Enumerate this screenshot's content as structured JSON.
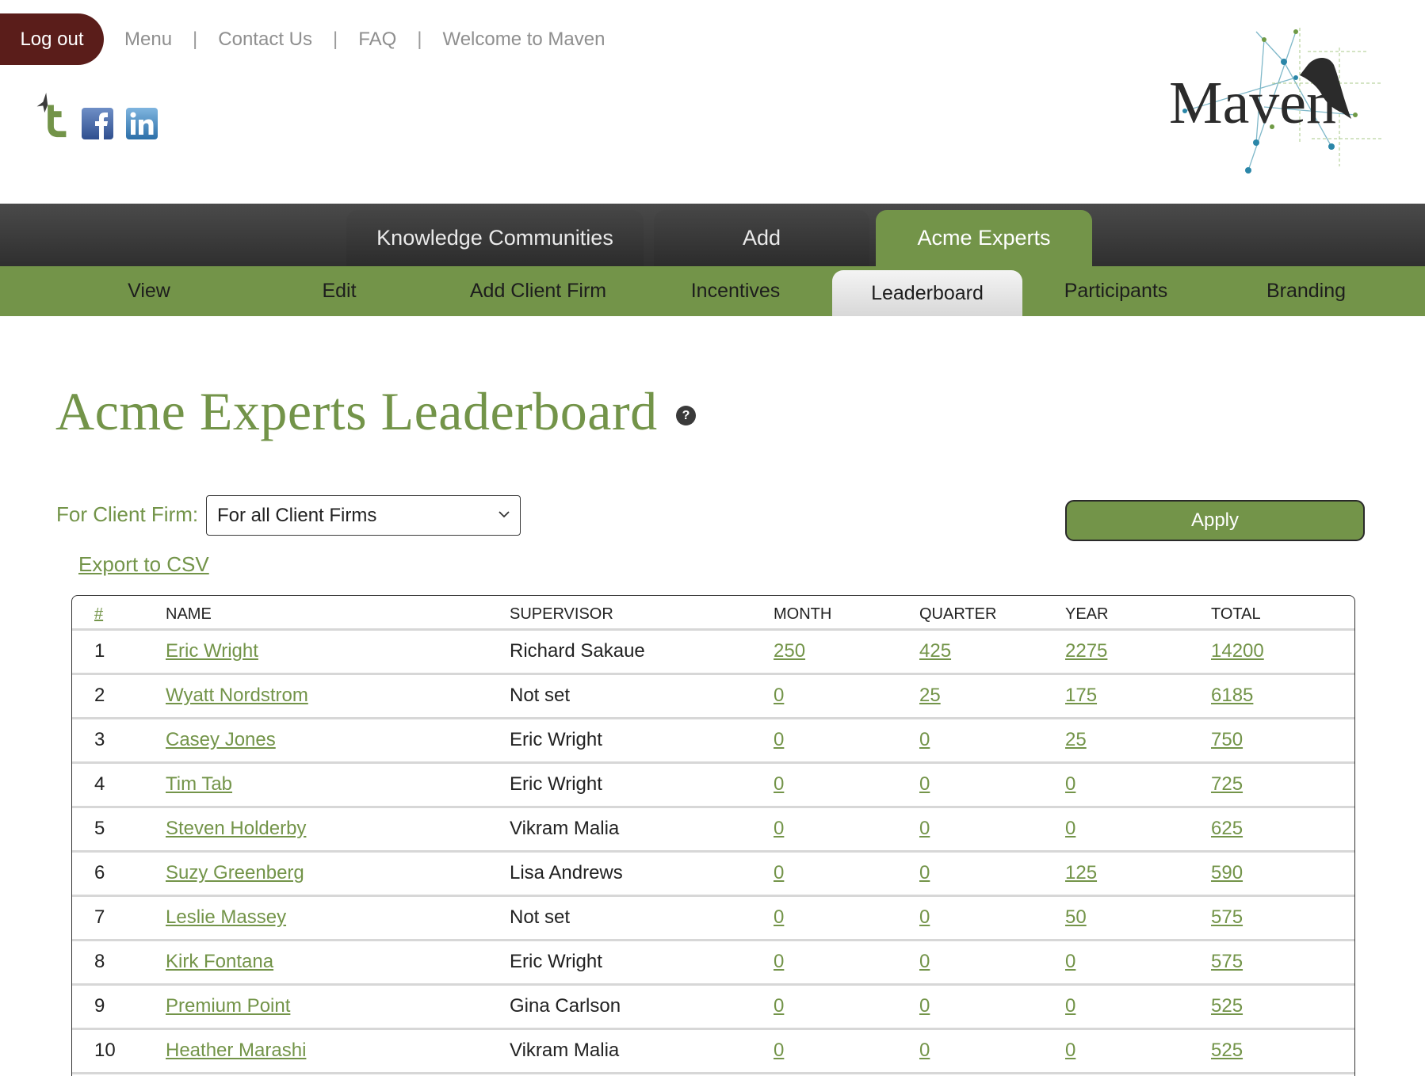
{
  "header": {
    "logout_label": "Log out",
    "links": [
      "Menu",
      "Contact Us",
      "FAQ",
      "Welcome to Maven"
    ],
    "separator": "|",
    "logo_text": "Maven"
  },
  "social": {
    "icons": [
      "twitter-icon",
      "facebook-icon",
      "linkedin-icon"
    ]
  },
  "nav_primary": {
    "tabs": [
      {
        "label": "Knowledge Communities",
        "active": false
      },
      {
        "label": "Add",
        "active": false
      },
      {
        "label": "Acme Experts",
        "active": true
      }
    ]
  },
  "nav_secondary": {
    "tabs": [
      {
        "label": "View",
        "active": false
      },
      {
        "label": "Edit",
        "active": false
      },
      {
        "label": "Add Client Firm",
        "active": false
      },
      {
        "label": "Incentives",
        "active": false
      },
      {
        "label": "Leaderboard",
        "active": true
      },
      {
        "label": "Participants",
        "active": false
      },
      {
        "label": "Branding",
        "active": false
      }
    ]
  },
  "main": {
    "title": "Acme Experts Leaderboard",
    "help_glyph": "?",
    "filter_label": "For Client Firm:",
    "filter_value": "For all Client Firms",
    "apply_label": "Apply",
    "export_label": "Export to CSV"
  },
  "leaderboard": {
    "columns": [
      "#",
      "NAME",
      "SUPERVISOR",
      "MONTH",
      "QUARTER",
      "YEAR",
      "TOTAL"
    ],
    "rows": [
      {
        "rank": "1",
        "name": "Eric Wright",
        "supervisor": "Richard Sakaue",
        "month": "250",
        "quarter": "425",
        "year": "2275",
        "total": "14200"
      },
      {
        "rank": "2",
        "name": "Wyatt Nordstrom",
        "supervisor": "Not set",
        "month": "0",
        "quarter": "25",
        "year": "175",
        "total": "6185"
      },
      {
        "rank": "3",
        "name": "Casey Jones",
        "supervisor": "Eric Wright",
        "month": "0",
        "quarter": "0",
        "year": "25",
        "total": "750"
      },
      {
        "rank": "4",
        "name": "Tim Tab",
        "supervisor": "Eric Wright",
        "month": "0",
        "quarter": "0",
        "year": "0",
        "total": "725"
      },
      {
        "rank": "5",
        "name": "Steven Holderby",
        "supervisor": "Vikram Malia",
        "month": "0",
        "quarter": "0",
        "year": "0",
        "total": "625"
      },
      {
        "rank": "6",
        "name": "Suzy Greenberg",
        "supervisor": "Lisa Andrews",
        "month": "0",
        "quarter": "0",
        "year": "125",
        "total": "590"
      },
      {
        "rank": "7",
        "name": "Leslie Massey",
        "supervisor": "Not set",
        "month": "0",
        "quarter": "0",
        "year": "50",
        "total": "575"
      },
      {
        "rank": "8",
        "name": "Kirk Fontana",
        "supervisor": "Eric Wright",
        "month": "0",
        "quarter": "0",
        "year": "0",
        "total": "575"
      },
      {
        "rank": "9",
        "name": "Premium Point",
        "supervisor": "Gina Carlson",
        "month": "0",
        "quarter": "0",
        "year": "0",
        "total": "525"
      },
      {
        "rank": "10",
        "name": "Heather Marashi",
        "supervisor": "Vikram Malia",
        "month": "0",
        "quarter": "0",
        "year": "0",
        "total": "525"
      }
    ]
  },
  "colors": {
    "brand_green": "#739449",
    "logout_maroon": "#5a1d1a",
    "nav_dark": "#3a3a3a"
  }
}
